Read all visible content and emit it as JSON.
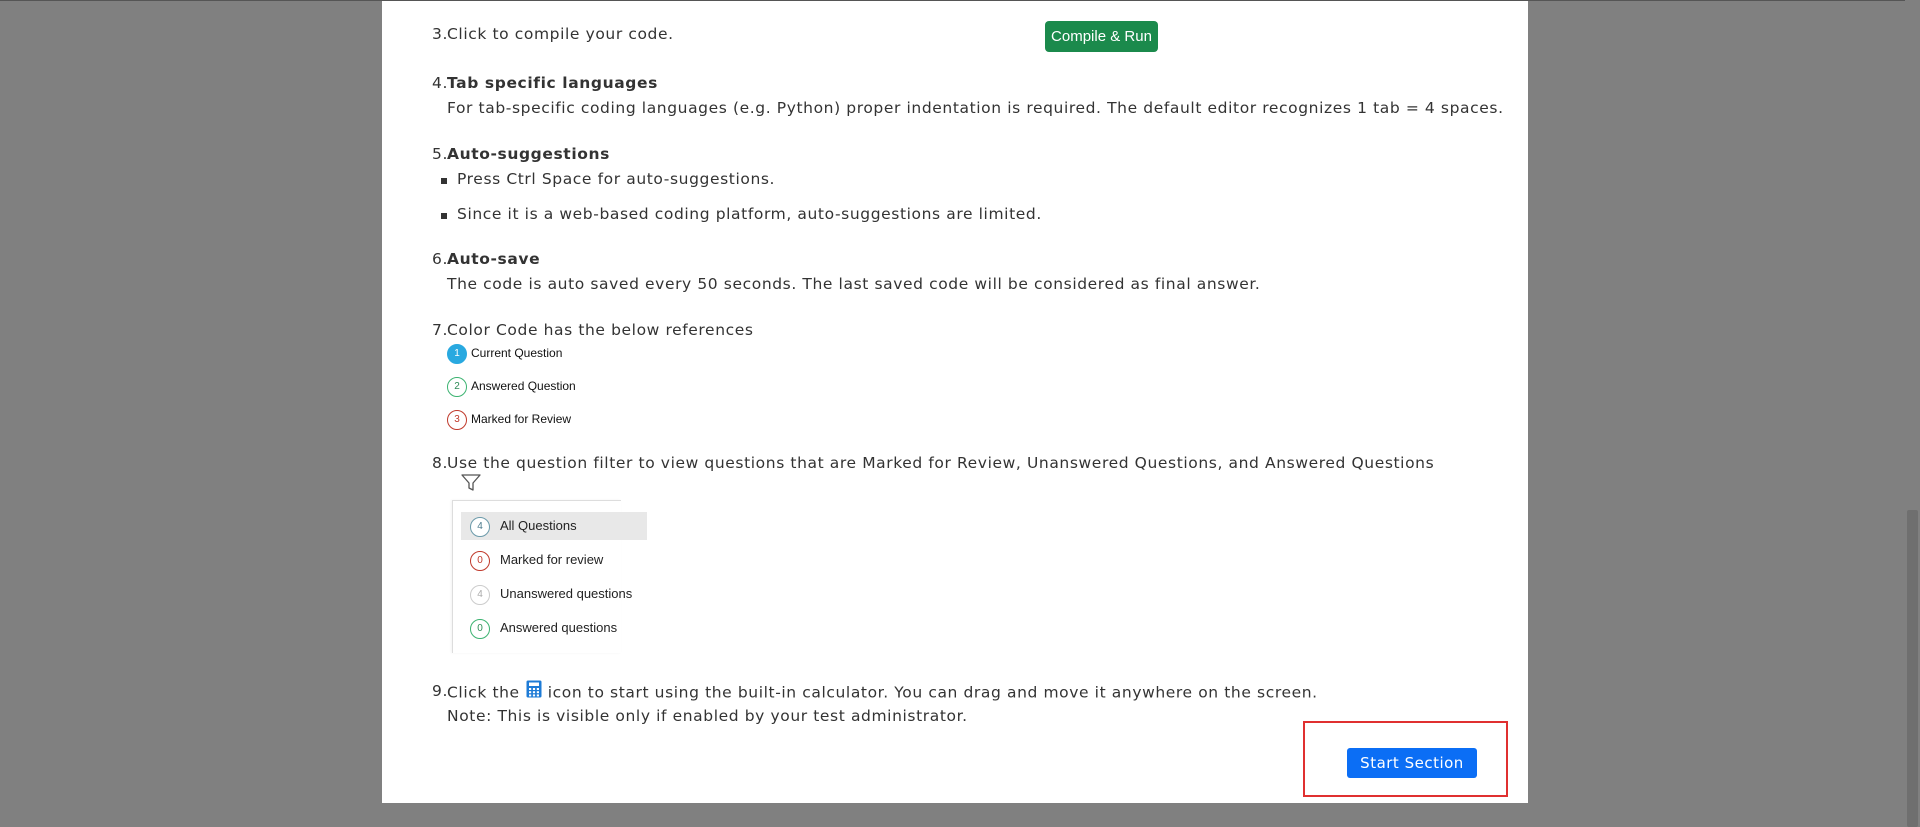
{
  "instructions": {
    "item3": {
      "num": "3.",
      "text": "Click to compile your code.",
      "button": "Compile & Run"
    },
    "item4": {
      "num": "4.",
      "title": "Tab specific languages",
      "text": "For tab-specific coding languages (e.g. Python) proper indentation is required. The default editor recognizes 1 tab = 4 spaces."
    },
    "item5": {
      "num": "5.",
      "title": "Auto-suggestions",
      "bullets": [
        "Press Ctrl Space for auto-suggestions.",
        "Since it is a web-based coding platform, auto-suggestions are limited."
      ]
    },
    "item6": {
      "num": "6.",
      "title": "Auto-save",
      "text": "The code is auto saved every 50 seconds. The last saved code will be considered as final answer."
    },
    "item7": {
      "num": "7.",
      "text": "Color Code has the below references",
      "legend": [
        {
          "badge": "1",
          "label": "Current Question",
          "color": "#29a9e0"
        },
        {
          "badge": "2",
          "label": "Answered Question",
          "color": "#3cb371"
        },
        {
          "badge": "3",
          "label": "Marked for Review",
          "color": "#c0392b"
        }
      ]
    },
    "item8": {
      "num": "8.",
      "text": "Use the question filter to view questions that are Marked for Review, Unanswered Questions, and Answered Questions",
      "filter_icon": "funnel-icon",
      "filters": [
        {
          "count": "4",
          "label": "All Questions",
          "selected": true
        },
        {
          "count": "0",
          "label": "Marked for review",
          "selected": false
        },
        {
          "count": "4",
          "label": "Unanswered questions",
          "selected": false
        },
        {
          "count": "0",
          "label": "Answered questions",
          "selected": false
        }
      ]
    },
    "item9": {
      "num": "9.",
      "text_before": "Click the",
      "icon": "calculator-icon",
      "text_after": "icon to start using the built-in calculator. You can drag and move it anywhere on the screen.",
      "note": "Note: This is visible only if enabled by your test administrator."
    }
  },
  "start_button": "Start Section",
  "colors": {
    "compile": "#1b8a4c",
    "start": "#0b6ef5",
    "highlight": "#e03030",
    "backdrop": "#808080"
  }
}
